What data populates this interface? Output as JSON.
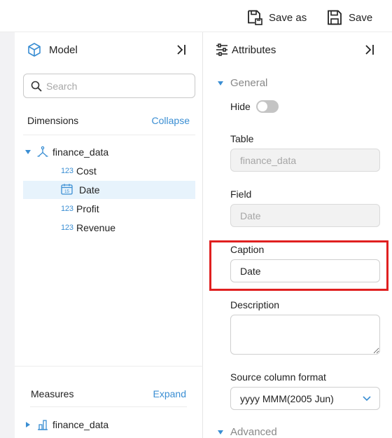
{
  "toolbar": {
    "save_as_label": "Save as",
    "save_label": "Save"
  },
  "model": {
    "title": "Model",
    "search_placeholder": "Search",
    "dimensions": {
      "label": "Dimensions",
      "action": "Collapse",
      "table": "finance_data",
      "fields": [
        {
          "type_icon": "123",
          "name": "Cost"
        },
        {
          "type_icon": "calendar-icon",
          "name": "Date"
        },
        {
          "type_icon": "123",
          "name": "Profit"
        },
        {
          "type_icon": "123",
          "name": "Revenue"
        }
      ]
    },
    "measures": {
      "label": "Measures",
      "action": "Expand",
      "table": "finance_data"
    }
  },
  "attributes": {
    "title": "Attributes",
    "general_label": "General",
    "hide_label": "Hide",
    "hide_value": false,
    "table_label": "Table",
    "table_value": "finance_data",
    "field_label": "Field",
    "field_value": "Date",
    "caption_label": "Caption",
    "caption_value": "Date",
    "description_label": "Description",
    "description_value": "",
    "source_format_label": "Source column format",
    "source_format_value": "yyyy MMM(2005 Jun)",
    "advanced_label": "Advanced"
  },
  "colors": {
    "accent": "#3a8ed3",
    "selected_row": "#e7f3fc",
    "highlight_border": "#e02020",
    "toggle_off": "#c4c4c4"
  }
}
